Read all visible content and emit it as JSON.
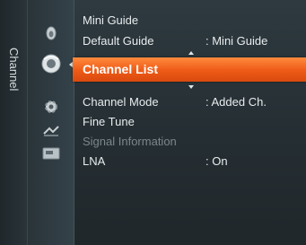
{
  "sidebar": {
    "tab_label": "Channel"
  },
  "icons": [
    "picture-icon",
    "channel-icon",
    "setup-icon",
    "input-icon",
    "application-icon"
  ],
  "menu": {
    "items": [
      {
        "label": "Mini Guide",
        "value": ""
      },
      {
        "label": "Default Guide",
        "value": ": Mini Guide"
      },
      {
        "label": "Channel List",
        "value": ""
      },
      {
        "label": "Channel Mode",
        "value": ": Added Ch."
      },
      {
        "label": "Fine Tune",
        "value": ""
      },
      {
        "label": "Signal Information",
        "value": ""
      },
      {
        "label": "LNA",
        "value": ": On"
      }
    ],
    "selected_index": 2
  },
  "colors": {
    "selection": "#ee5a16",
    "background": "#2e3a40",
    "disabled_text": "#7b868c"
  }
}
